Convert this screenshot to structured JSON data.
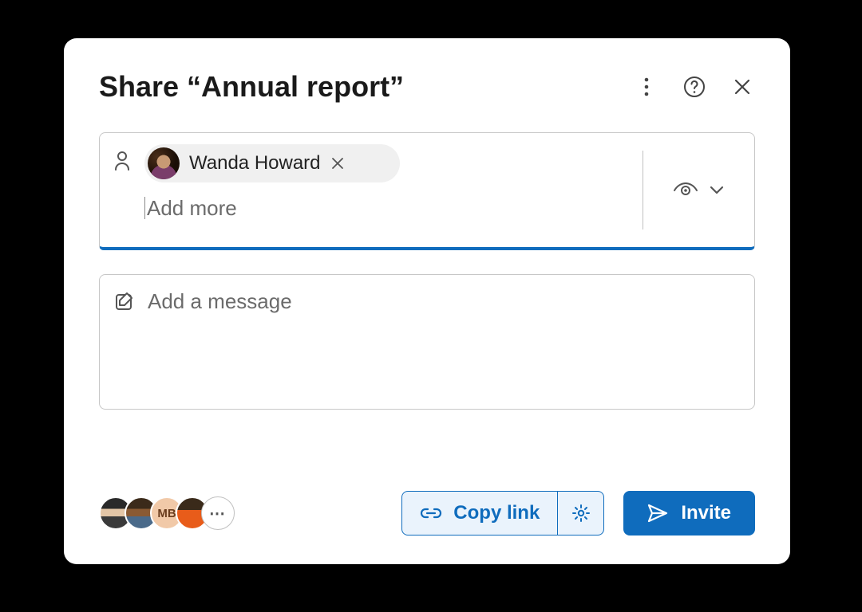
{
  "dialog": {
    "title": "Share “Annual report”"
  },
  "people": {
    "chips": [
      {
        "name": "Wanda Howard"
      }
    ],
    "addMorePlaceholder": "Add more",
    "permissionIcon": "view-icon"
  },
  "message": {
    "placeholder": "Add a message"
  },
  "sharedWith": {
    "avatars": [
      "user-1",
      "user-2",
      "MB",
      "user-4"
    ],
    "more": "⋯"
  },
  "actions": {
    "copyLink": "Copy link",
    "invite": "Invite"
  }
}
